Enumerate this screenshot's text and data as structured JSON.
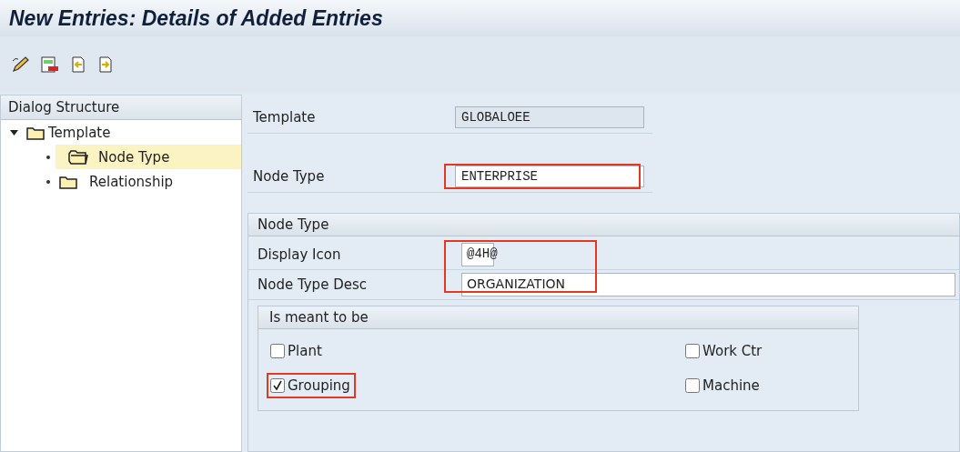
{
  "window": {
    "title": "New Entries: Details of Added Entries"
  },
  "toolbar": [
    {
      "kind": "edit"
    },
    {
      "kind": "delete"
    },
    {
      "kind": "previous"
    },
    {
      "kind": "next"
    }
  ],
  "sidebar": {
    "title": "Dialog Structure",
    "items": [
      {
        "label": "Template",
        "expanded": true,
        "selected": false,
        "children": [
          {
            "label": "Node Type",
            "selected": true
          },
          {
            "label": "Relationship",
            "selected": false
          }
        ]
      }
    ]
  },
  "header_fields": [
    {
      "label": "Template",
      "value": "GLOBALOEE",
      "disabled": true
    },
    {
      "label": "Node Type",
      "value": "ENTERPRISE",
      "disabled": false,
      "highlighted": true
    }
  ],
  "node_type": {
    "title": "Node Type",
    "highlighted": true,
    "fields": [
      {
        "label": "Display Icon",
        "value": "@4H@",
        "kind": "short"
      },
      {
        "label": "Node Type Desc",
        "value": "ORGANIZATION",
        "kind": "long"
      }
    ],
    "options": {
      "title": "Is meant to be",
      "items": [
        {
          "label": "Plant",
          "checked": false
        },
        {
          "label": "Work Ctr",
          "checked": false
        },
        {
          "label": "Grouping",
          "checked": true,
          "highlighted": true
        },
        {
          "label": "Machine",
          "checked": false
        }
      ]
    }
  }
}
